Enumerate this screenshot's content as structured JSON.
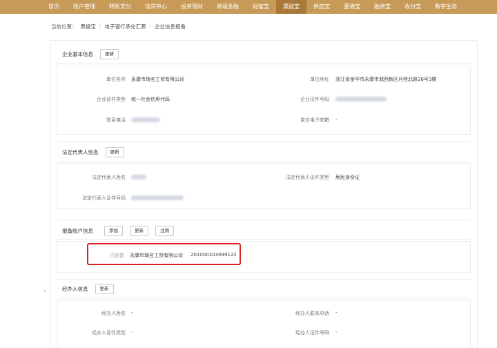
{
  "nav": {
    "items": [
      "首页",
      "账户管理",
      "转账支付",
      "信贷中心",
      "投资理财",
      "跨境金融",
      "财富宝",
      "票据宝",
      "供应宝",
      "惠通宝",
      "融资宝",
      "收付宝",
      "数字生态"
    ],
    "active_index": 7
  },
  "breadcrumb": {
    "prefix": "当前位置：",
    "items": [
      "票据宝",
      "电子银行承兑汇票",
      "企业信息报备"
    ],
    "separator": "/"
  },
  "basic_info": {
    "title": "企业基本信息",
    "update_btn": "更新",
    "unit_name_label": "单位名称",
    "unit_name": "永康市琦名工贸有限公司",
    "unit_address_label": "单位地址",
    "unit_address": "浙江省金华市永康市城西新区月桂北路26号3楼",
    "cert_type_label": "企业证件类型",
    "cert_type": "统一社会信用代码",
    "cert_no_label": "企业证件号码",
    "phone_label": "联系电话",
    "email_label": "单位电子邮箱",
    "email": "-"
  },
  "legal_rep": {
    "title": "法定代表人信息",
    "update_btn": "更新",
    "name_label": "法定代表人姓名",
    "cert_type_label": "法定代表人证件类型",
    "cert_type": "居民身份证",
    "cert_no_label": "法定代表人证件号码"
  },
  "account": {
    "title": "报备账户信息",
    "add_btn": "添加",
    "update_btn": "更新",
    "cancel_btn": "注销",
    "status": "已报备",
    "account_name": "永康市琦名工贸有限公司",
    "account_no": "201000203099122"
  },
  "agent": {
    "title": "经办人信息",
    "update_btn": "更新",
    "name_label": "经办人姓名",
    "name": "-",
    "phone_label": "经办人联系电话",
    "phone": "-",
    "cert_type_label": "经办人证件类型",
    "cert_type": "-",
    "cert_no_label": "经办人证件号码",
    "cert_no": "-"
  },
  "colors": {
    "nav_bg": "#c89a57",
    "nav_active": "#a9783a",
    "highlight": "#e02020"
  }
}
